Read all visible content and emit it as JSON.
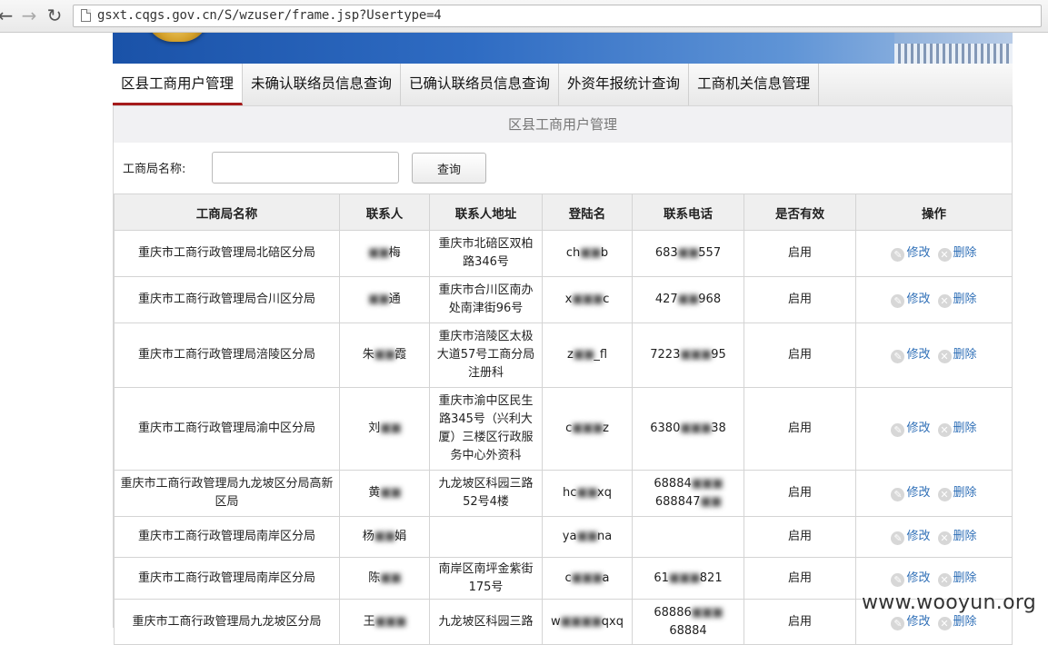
{
  "browser": {
    "url": "gsxt.cqgs.gov.cn/S/wzuser/frame.jsp?Usertype=4",
    "back_glyph": "←",
    "forward_glyph": "→",
    "reload_glyph": "↻"
  },
  "tabs": [
    {
      "label": "区县工商用户管理",
      "active": true
    },
    {
      "label": "未确认联络员信息查询",
      "active": false
    },
    {
      "label": "已确认联络员信息查询",
      "active": false
    },
    {
      "label": "外资年报统计查询",
      "active": false
    },
    {
      "label": "工商机关信息管理",
      "active": false
    }
  ],
  "section_title": "区县工商用户管理",
  "search": {
    "label": "工商局名称:",
    "value": "",
    "button_label": "查询"
  },
  "table": {
    "columns": [
      "工商局名称",
      "联系人",
      "联系人地址",
      "登陆名",
      "联系电话",
      "是否有效",
      "操作"
    ],
    "edit_label": "修改",
    "delete_label": "删除",
    "rows": [
      {
        "name": "重庆市工商行政管理局北碚区分局",
        "contact": "■■梅",
        "address": "重庆市北碚区双柏路346号",
        "login": "ch■■b",
        "phone": "683■■557",
        "valid": "启用"
      },
      {
        "name": "重庆市工商行政管理局合川区分局",
        "contact": "■■通",
        "address": "重庆市合川区南办处南津街96号",
        "login": "x■■■c",
        "phone": "427■■968",
        "valid": "启用"
      },
      {
        "name": "重庆市工商行政管理局涪陵区分局",
        "contact": "朱■■霞",
        "address": "重庆市涪陵区太极大道57号工商分局注册科",
        "login": "z■■_fl",
        "phone": "7223■■■95",
        "valid": "启用"
      },
      {
        "name": "重庆市工商行政管理局渝中区分局",
        "contact": "刘■■",
        "address": "重庆市渝中区民生路345号（兴利大厦）三楼区行政服务中心外资科",
        "login": "c■■■z",
        "phone": "6380■■■38",
        "valid": "启用"
      },
      {
        "name": "重庆市工商行政管理局九龙坡区分局高新区局",
        "contact": "黄■■",
        "address": "九龙坡区科园三路52号4楼",
        "login": "hc■■xq",
        "phone": "68884■■■ 688847■■",
        "valid": "启用"
      },
      {
        "name": "重庆市工商行政管理局南岸区分局",
        "contact": "杨■■娟",
        "address": "",
        "login": "ya■■na",
        "phone": "",
        "valid": "启用"
      },
      {
        "name": "重庆市工商行政管理局南岸区分局",
        "contact": "陈■■",
        "address": "南岸区南坪金紫街175号",
        "login": "c■■■a",
        "phone": "61■■■821",
        "valid": "启用"
      },
      {
        "name": "重庆市工商行政管理局九龙坡区分局",
        "contact": "王■■■",
        "address": "九龙坡区科园三路",
        "login": "w■■■■qxq",
        "phone": "68886■■■ 68884",
        "valid": "启用"
      }
    ]
  },
  "watermark": "www.wooyun.org",
  "colors": {
    "tab_active_underline": "#a51b1b",
    "link_blue": "#2f6fb7"
  },
  "icons": {
    "edit": "pencil-icon",
    "delete": "close-circle-icon",
    "page": "page-icon"
  }
}
